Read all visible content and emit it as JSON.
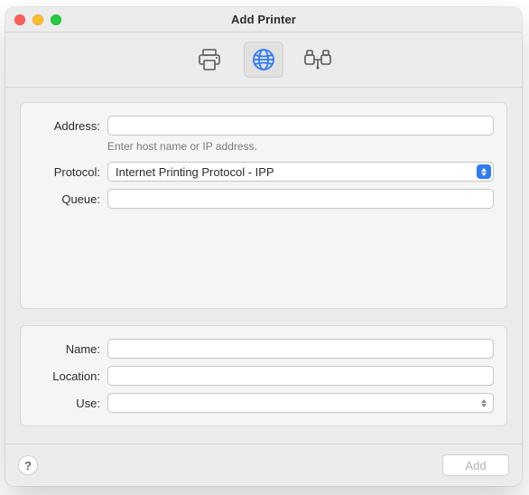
{
  "window": {
    "title": "Add Printer"
  },
  "tabs": {
    "default_icon": "printer-icon",
    "ip_icon": "globe-icon",
    "windows_icon": "network-printer-icon",
    "selected": "ip"
  },
  "top_form": {
    "address": {
      "label": "Address:",
      "value": "",
      "hint": "Enter host name or IP address."
    },
    "protocol": {
      "label": "Protocol:",
      "value": "Internet Printing Protocol - IPP"
    },
    "queue": {
      "label": "Queue:",
      "value": ""
    }
  },
  "bottom_form": {
    "name": {
      "label": "Name:",
      "value": ""
    },
    "location": {
      "label": "Location:",
      "value": ""
    },
    "use": {
      "label": "Use:",
      "value": ""
    }
  },
  "buttons": {
    "help": "?",
    "add": "Add"
  }
}
